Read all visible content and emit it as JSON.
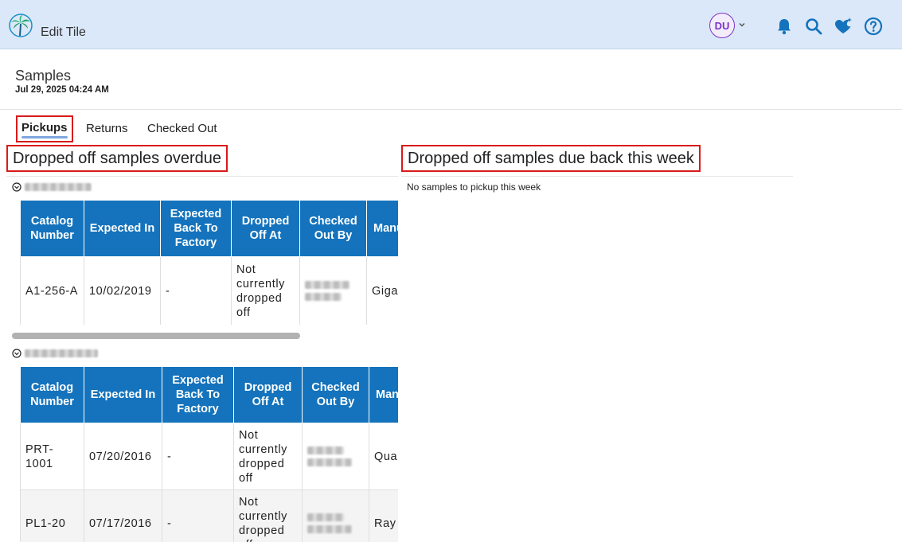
{
  "header": {
    "app_title": "Edit Tile",
    "avatar_initials": "DU",
    "accent_color": "#1473bc",
    "avatar_color": "#7a35c7"
  },
  "page": {
    "title": "Samples",
    "timestamp": "Jul 29, 2025 04:24 AM"
  },
  "tabs": [
    {
      "label": "Pickups",
      "active": true
    },
    {
      "label": "Returns",
      "active": false
    },
    {
      "label": "Checked Out",
      "active": false
    }
  ],
  "left_section": {
    "title": "Dropped off samples overdue",
    "columns": [
      "Catalog Number",
      "Expected In",
      "Expected Back To Factory",
      "Dropped Off At",
      "Checked Out By",
      "Manufacturer"
    ],
    "groups": [
      {
        "rows": [
          {
            "catalog": "A1-256-A",
            "expected_in": "10/02/2019",
            "back_to_factory": "-",
            "dropped_off_at": "Not currently dropped off",
            "manufacturer": "Giga Fixtu Lam"
          }
        ]
      },
      {
        "rows": [
          {
            "catalog": "PRT-1001",
            "expected_in": "07/20/2016",
            "back_to_factory": "-",
            "dropped_off_at": "Not currently dropped off",
            "manufacturer": "Qua Man"
          },
          {
            "catalog": "PL1-20",
            "expected_in": "07/17/2016",
            "back_to_factory": "-",
            "dropped_off_at": "Not currently dropped off",
            "manufacturer": "Ray Ligh"
          }
        ]
      }
    ]
  },
  "right_section": {
    "title": "Dropped off samples due back this week",
    "empty_message": "No samples to pickup this week"
  }
}
